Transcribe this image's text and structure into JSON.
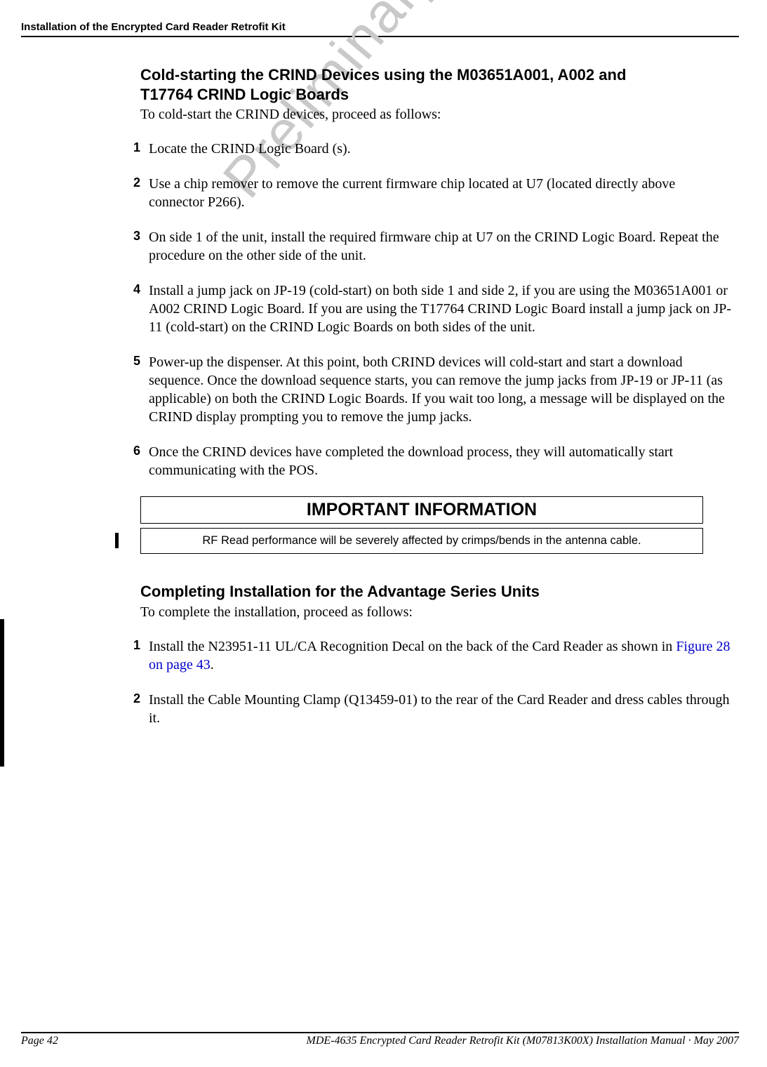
{
  "header": "Installation of the Encrypted Card Reader Retrofit Kit",
  "watermark": "Preliminary",
  "section1": {
    "title_line1": "Cold-starting the CRIND Devices using the M03651A001, A002 and",
    "title_line2": " T17764 CRIND Logic Boards",
    "intro": "To cold-start the CRIND devices, proceed as follows:",
    "steps": [
      {
        "n": "1",
        "t": "Locate the CRIND Logic Board (s)."
      },
      {
        "n": "2",
        "t": "Use a chip remover to remove the current firmware chip located at U7 (located directly above connector P266)."
      },
      {
        "n": "3",
        "t": "On side 1 of the unit, install the required firmware chip at U7 on the CRIND Logic Board. Repeat the procedure on the other side of the unit."
      },
      {
        "n": "4",
        "t": "Install a jump jack on JP-19 (cold-start) on both side 1 and side 2, if you are using the M03651A001 or A002 CRIND Logic Board. If you are using the T17764 CRIND Logic Board install a jump jack on JP-11 (cold-start) on the CRIND Logic Boards on both sides of the unit."
      },
      {
        "n": "5",
        "t": "Power-up the dispenser. At this point, both CRIND devices will cold-start and start a download sequence. Once the download sequence starts, you can remove the jump jacks from JP-19 or JP-11 (as applicable) on both the CRIND Logic Boards. If you wait too long, a message will be displayed on the CRIND display prompting you to remove the jump jacks."
      },
      {
        "n": "6",
        "t": "Once the CRIND devices have completed the download process, they will automatically start communicating with the POS."
      }
    ]
  },
  "important": {
    "heading": "IMPORTANT INFORMATION",
    "text": "RF Read performance will be severely affected by crimps/bends in the antenna cable."
  },
  "section2": {
    "title": "Completing Installation for the Advantage Series Units",
    "intro": "To complete the installation, proceed as follows:",
    "steps": [
      {
        "n": "1",
        "pre": "Install the N23951-11 UL/CA Recognition Decal on the back of the Card Reader as shown in ",
        "link": "Figure 28 on page 43",
        "post": "."
      },
      {
        "n": "2",
        "t": "Install the Cable Mounting Clamp (Q13459-01) to the rear of the Card Reader and dress cables through it."
      }
    ]
  },
  "footer": {
    "left": "Page 42",
    "right": "MDE-4635 Encrypted Card Reader Retrofit Kit (M07813K00X) Installation Manual · May 2007"
  }
}
